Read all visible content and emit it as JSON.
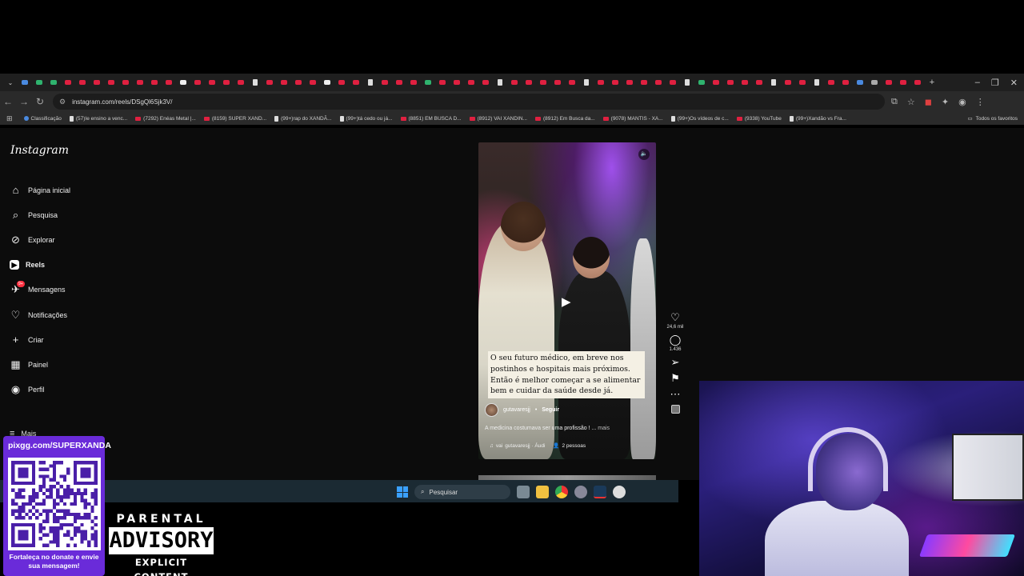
{
  "browser": {
    "url": "instagram.com/reels/DSgQl6Sjk3V/",
    "bookmarks": [
      {
        "label": "Classificação",
        "kind": "bl"
      },
      {
        "label": "(57)Ie ensino a venc...",
        "kind": "tk"
      },
      {
        "label": "(7292) Enéas Metal |...",
        "kind": "yt"
      },
      {
        "label": "(8159) SUPER XAND...",
        "kind": "yt"
      },
      {
        "label": "(99+)rap do XANDÃ...",
        "kind": "tk"
      },
      {
        "label": "(99+)tá cedo ou já...",
        "kind": "tk"
      },
      {
        "label": "(8851) EM BUSCA D...",
        "kind": "yt"
      },
      {
        "label": "(8912) VAI XANDIN...",
        "kind": "yt"
      },
      {
        "label": "(8912) Em Busca da...",
        "kind": "yt"
      },
      {
        "label": "(9078) MANTIS - XA...",
        "kind": "yt"
      },
      {
        "label": "(99+)Os vídeos de c...",
        "kind": "tk"
      },
      {
        "label": "(9338) YouTube",
        "kind": "yt"
      },
      {
        "label": "(99+)Xandão vs Fra...",
        "kind": "tk"
      }
    ],
    "all_bookmarks_label": "Todos os favoritos"
  },
  "instagram": {
    "logo": "Instagram",
    "nav": [
      {
        "label": "Página inicial",
        "icon": "home-icon"
      },
      {
        "label": "Pesquisa",
        "icon": "search-icon"
      },
      {
        "label": "Explorar",
        "icon": "compass-icon"
      },
      {
        "label": "Reels",
        "icon": "reels-icon",
        "active": true
      },
      {
        "label": "Mensagens",
        "icon": "messages-icon",
        "badge": "9+"
      },
      {
        "label": "Notificações",
        "icon": "heart-icon"
      },
      {
        "label": "Criar",
        "icon": "plus-icon"
      },
      {
        "label": "Painel",
        "icon": "chart-icon"
      },
      {
        "label": "Perfil",
        "icon": "avatar-icon"
      }
    ],
    "more_label": "Mais",
    "reel": {
      "caption": "O seu futuro médico, em breve nos postinhos e hospitais mais próximos. Então é melhor começar a se alimentar bem e cuidar da saúde desde já.",
      "author": "gutavaresjj",
      "separator": "•",
      "follow_label": "Seguir",
      "description": "A medicina costumava ser uma profissão ! ...",
      "more_label": "mais",
      "audio_prefix": "vai",
      "audio": "gutavaresjj · Áudi",
      "people": "2 pessoas"
    },
    "actions": {
      "likes": "24,6 mil",
      "comments": "1.436"
    }
  },
  "taskbar": {
    "search_placeholder": "Pesquisar"
  },
  "overlay": {
    "pix_url": "pixgg.com/SUPERXANDA",
    "pix_message": "Fortaleça no donate e envie sua mensagem!",
    "advisory_top": "PARENTAL",
    "advisory_mid": "ADVISORY",
    "advisory_bottom": "EXPLICIT CONTENT"
  },
  "colors": {
    "chrome_bg": "#1f1f1f",
    "page_bg": "#0c0c0c",
    "taskbar_bg": "#1b2a33",
    "pix_panel": "#6a2bd9",
    "badge": "#ff3040"
  }
}
